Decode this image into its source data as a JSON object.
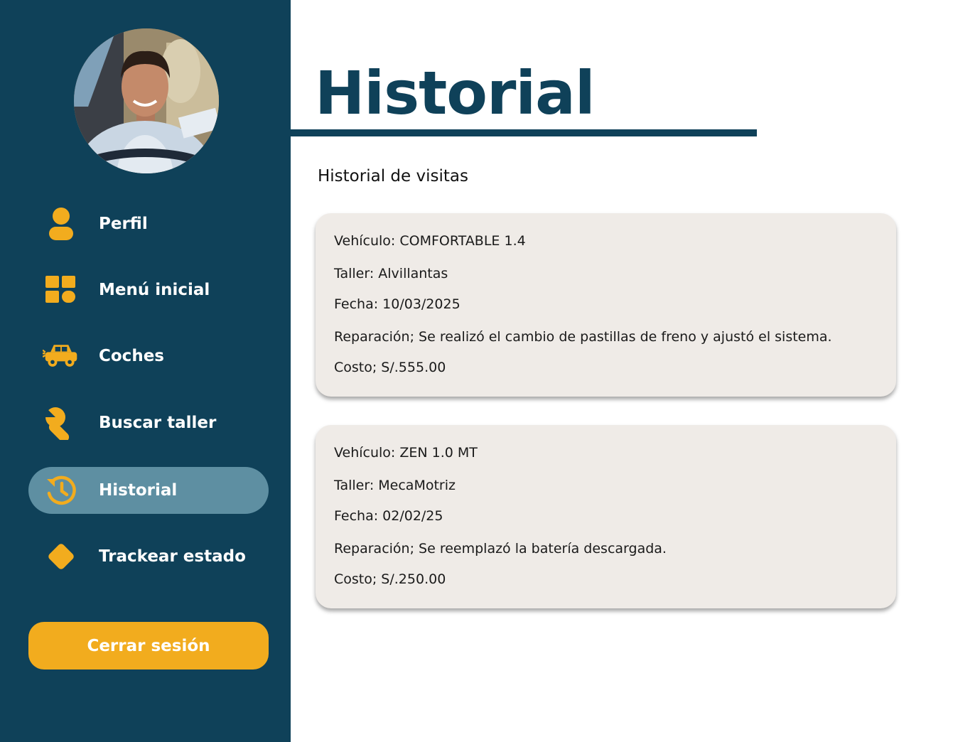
{
  "sidebar": {
    "items": [
      {
        "label": "Perfil",
        "icon": "user-icon"
      },
      {
        "label": "Menú inicial",
        "icon": "grid-icon"
      },
      {
        "label": "Coches",
        "icon": "car-icon"
      },
      {
        "label": "Buscar taller",
        "icon": "wrench-icon"
      },
      {
        "label": "Historial",
        "icon": "history-icon",
        "active": true
      },
      {
        "label": "Trackear estado",
        "icon": "diamond-icon"
      }
    ],
    "logout_label": "Cerrar sesión"
  },
  "main": {
    "title": "Historial",
    "subtitle": "Historial de visitas",
    "visits": [
      {
        "vehiculo": "Vehículo: COMFORTABLE 1.4",
        "taller": "Taller: Alvillantas",
        "fecha": "Fecha: 10/03/2025",
        "reparacion": "Reparación; Se realizó el cambio de pastillas de freno y ajustó el sistema.",
        "costo": "Costo;  S/.555.00"
      },
      {
        "vehiculo": "Vehículo: ZEN 1.0 MT",
        "taller": "Taller: MecaMotriz",
        "fecha": "Fecha: 02/02/25",
        "reparacion": "Reparación; Se reemplazó la batería descargada.",
        "costo": "Costo;  S/.250.00"
      }
    ]
  },
  "colors": {
    "sidebar_bg": "#0f4159",
    "accent": "#f2ac1e",
    "active_item_bg": "#5e8fa2",
    "card_bg": "#efebe7",
    "title": "#0f4159"
  }
}
